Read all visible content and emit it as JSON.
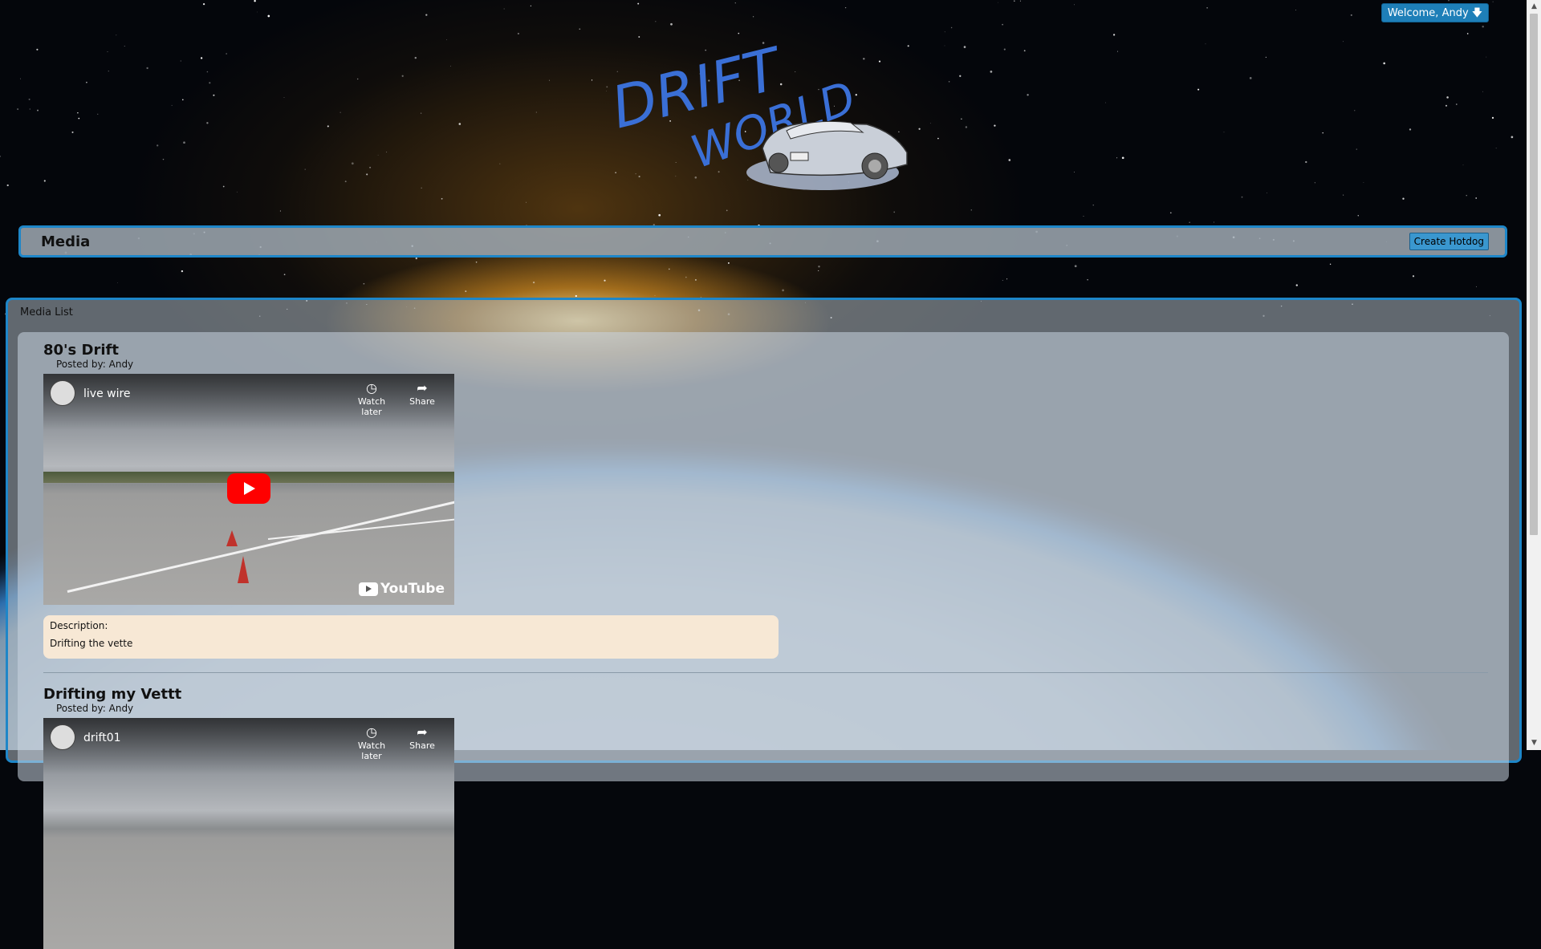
{
  "user": {
    "welcome_label": "Welcome, Andy 🡇"
  },
  "logo": {
    "line1": "DRIFT",
    "line2": "WORLD"
  },
  "header": {
    "title": "Media",
    "create_label": "Create Hotdog"
  },
  "panel": {
    "label": "Media List"
  },
  "posts": [
    {
      "title": "80's Drift",
      "posted_by": "Posted by: Andy",
      "video": {
        "channel": "live wire",
        "watch_later": "Watch later",
        "share": "Share",
        "brand": "YouTube"
      },
      "description_label": "Description:",
      "description": "Drifting the vette"
    },
    {
      "title": "Drifting my Vettt",
      "posted_by": "Posted by: Andy",
      "video": {
        "channel": "drift01",
        "watch_later": "Watch later",
        "share": "Share"
      }
    }
  ],
  "colors": {
    "accent": "#1e86c8",
    "button": "#3a97cf",
    "description_bg": "#f7e8d5",
    "logo_text": "#3a6fd6"
  }
}
